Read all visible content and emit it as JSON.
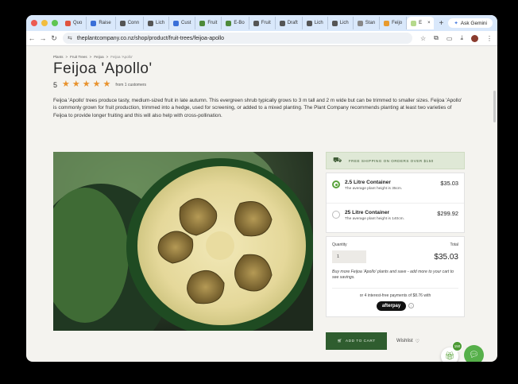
{
  "browser": {
    "tabs": [
      {
        "label": "Quo",
        "color": "#e0533f"
      },
      {
        "label": "Raise",
        "color": "#3a6fd8"
      },
      {
        "label": "Conn",
        "color": "#555555"
      },
      {
        "label": "Lich",
        "color": "#555555"
      },
      {
        "label": "Cust",
        "color": "#3a6fd8"
      },
      {
        "label": "Fruit",
        "color": "#4e8a3a"
      },
      {
        "label": "E-Bo",
        "color": "#4e8a3a"
      },
      {
        "label": "Fruit",
        "color": "#555555"
      },
      {
        "label": "Draft",
        "color": "#555555"
      },
      {
        "label": "Lich",
        "color": "#555555"
      },
      {
        "label": "Lich",
        "color": "#555555"
      },
      {
        "label": "Stan",
        "color": "#888888"
      },
      {
        "label": "Feijo",
        "color": "#e89a2e"
      },
      {
        "label": "E",
        "color": "#b5d98c"
      }
    ],
    "active_close": "×",
    "new_tab": "+",
    "gemini_label": "Ask Gemini",
    "url": "theplantcompany.co.nz/shop/product/fruit-trees/feijoa-apollo"
  },
  "breadcrumb": {
    "items": [
      "Plants",
      "Fruit Trees",
      "Feijoa"
    ],
    "current": "Feijoa 'Apollo'",
    "sep": ">"
  },
  "product": {
    "title": "Feijoa 'Apollo'",
    "rating_value": "5",
    "stars": 5,
    "rating_count": "from 1 customers",
    "description": "Feijoa 'Apollo' trees produce tasty, medium-sized fruit in late autumn. This evergreen shrub typically grows to 3 m tall and 2 m wide but can be trimmed to smaller sizes. Feijoa 'Apollo' is commonly grown for fruit production, trimmed into a hedge, used for screening, or added to a mixed planting. The Plant Company recommends planting at least two varieties of Feijoa to provide longer fruiting and this will also help with cross-pollination."
  },
  "shipping_banner": "FREE SHIPPING ON ORDERS OVER $150",
  "options": [
    {
      "name": "2.5 Litre Container",
      "sub": "The average plant height is 35cm.",
      "price": "$35.03",
      "selected": true
    },
    {
      "name": "25 Litre Container",
      "sub": "The average plant height is 140cm.",
      "price": "$299.92",
      "selected": false
    }
  ],
  "purchase": {
    "quantity_label": "Quantity",
    "total_label": "Total",
    "quantity_value": "1",
    "total_value": "$35.03",
    "promo": "Buy more Feijoa 'Apollo' plants and save - add more to your cart to see savings.",
    "afterpay_text": "or 4 interest-free payments of $8.76 with",
    "afterpay_logo": "afterpay",
    "info": "i"
  },
  "actions": {
    "add_to_cart": "ADD TO CART",
    "wishlist": "Wishlist"
  },
  "gift_badge": "150",
  "colors": {
    "accent_green": "#2f5d2f",
    "star": "#e8922c",
    "radio_green": "#5aa33c",
    "chat_green": "#56b04a"
  }
}
